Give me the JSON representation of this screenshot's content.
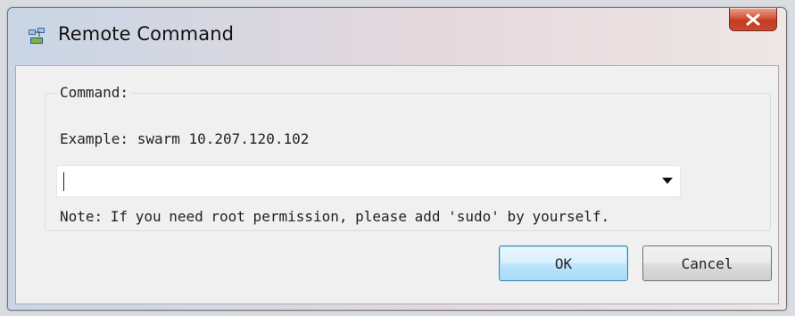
{
  "window": {
    "title": "Remote Command",
    "close_label": "X"
  },
  "command_group": {
    "label": "Command:",
    "example": "Example: swarm 10.207.120.102",
    "input_value": "",
    "input_placeholder": "",
    "note": "Note: If you need root permission, please add 'sudo' by yourself."
  },
  "buttons": {
    "ok": "OK",
    "cancel": "Cancel"
  },
  "icons": {
    "app": "remote-terminal-icon",
    "close": "close-icon",
    "dropdown": "dropdown-arrow-icon"
  },
  "colors": {
    "close_button": "#c84a30",
    "ok_focus_border": "#3c7fb1"
  }
}
